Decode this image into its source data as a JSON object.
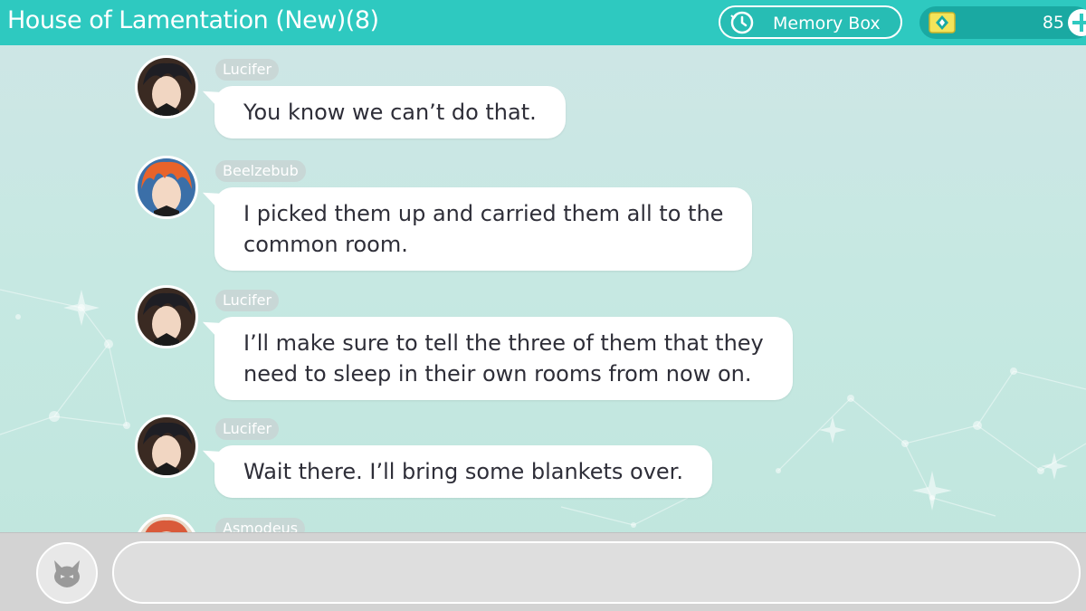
{
  "header": {
    "title": "House of Lamentation (New)(8)",
    "memory_box_label": "Memory Box",
    "currency_value": "85"
  },
  "messages": [
    {
      "sender": "Lucifer",
      "text_lines": [
        "You know we can’t do that."
      ],
      "avatar": "lucifer-avatar"
    },
    {
      "sender": "Beelzebub",
      "text_lines": [
        "I picked them up and carried them all to the",
        "common room."
      ],
      "avatar": "beelzebub-avatar"
    },
    {
      "sender": "Lucifer",
      "text_lines": [
        "I’ll make sure to tell the three of them that they",
        "need to sleep in their own rooms from now on."
      ],
      "avatar": "lucifer-avatar"
    },
    {
      "sender": "Lucifer",
      "text_lines": [
        "Wait there. I’ll bring some blankets over."
      ],
      "avatar": "lucifer-avatar"
    },
    {
      "sender": "Asmodeus",
      "text_lines": [],
      "avatar": "asmodeus-avatar"
    }
  ],
  "footer": {
    "input_value": "",
    "input_placeholder": ""
  },
  "icons": {
    "memory": "history-clock-icon",
    "currency": "gem-icon",
    "add": "plus-icon",
    "stamp": "devil-stamp-icon"
  },
  "colors": {
    "header": "#2ec9c0",
    "bubble": "#ffffff",
    "text": "#2e2e38",
    "footer": "#d3d3d3"
  }
}
